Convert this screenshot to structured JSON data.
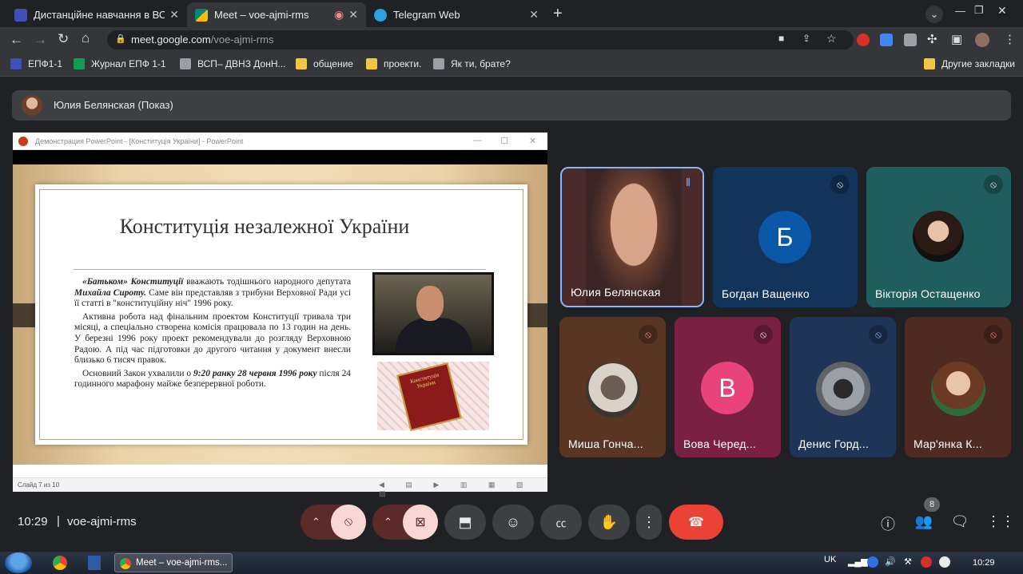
{
  "browser": {
    "tabs": [
      {
        "label": "Дистанційне навчання в ВСП",
        "icon": "forms-icon",
        "color": "#3f51b5"
      },
      {
        "label": "Meet – voe-ajmi-rms",
        "icon": "meet-icon",
        "color": "#00897b"
      },
      {
        "label": "Telegram Web",
        "icon": "telegram-icon",
        "color": "#2aa3df"
      }
    ],
    "url_host": "meet.google.com",
    "url_path": "/voe-ajmi-rms",
    "bookmarks": [
      {
        "label": "ЕПФ1-1",
        "color": "#3f51b5"
      },
      {
        "label": "Журнал ЕПФ 1-1",
        "color": "#0f9d58"
      },
      {
        "label": "ВСП– ДВНЗ ДонН...",
        "color": "#9aa0a6"
      },
      {
        "label": "общение",
        "color": "#f4c542"
      },
      {
        "label": "проекти.",
        "color": "#f4c542"
      },
      {
        "label": "Як ти, брате?",
        "color": "#9aa0a6"
      }
    ],
    "other_bookmarks": "Другие закладки"
  },
  "meet": {
    "presenter_label": "Юлия Белянская (Показ)",
    "ppt": {
      "window_title": "Демонстрация PowerPoint - [Конституція України] - PowerPoint",
      "slide_title": "Конституція незалежної України",
      "p1_a": "«Батьком» Конституції",
      "p1_b": " вважають тодішнього народного депутата ",
      "p1_c": "Михайла Сироту.",
      "p1_d": " Саме він представляв з трибуни Верховної Ради усі її статті в \"конституційну ніч\" 1996 року.",
      "p2": "Активна робота над фінальним проектом Конституції тривала три місяці, а спеціально створена комісія працювала по 13 годин на день. У березні 1996 року проект рекомендували до розгляду Верховною Радою. А під час підготовки до другого читання у документ внесли близько 6 тисяч правок.",
      "p3_a": "Основний Закон ухвалили о ",
      "p3_b": "9:20 ранку 28 червня 1996 року",
      "p3_c": " після 24 годинного марафону майже безперервної роботи.",
      "book_text": "Конституція України",
      "status": "Слайд 7 из 10"
    },
    "participants": [
      {
        "name": "Юлия Белянская",
        "type": "video",
        "bg": "#4a2b2a"
      },
      {
        "name": "Богдан Ващенко",
        "type": "letter",
        "letter": "Б",
        "bg": "#12345a",
        "circle": "#0b57a8"
      },
      {
        "name": "Вікторія Остащенко",
        "type": "photo",
        "bg": "#1f5e5c"
      },
      {
        "name": "Миша Гонча...",
        "type": "photo",
        "bg": "#5a3524"
      },
      {
        "name": "Вова Черед...",
        "type": "letter",
        "letter": "В",
        "bg": "#7a2043",
        "circle": "#e8437a"
      },
      {
        "name": "Денис Горд...",
        "type": "photo",
        "bg": "#1e3557"
      },
      {
        "name": "Мар'янка К...",
        "type": "photo",
        "bg": "#4e2a20"
      }
    ],
    "clock": "10:29",
    "meeting_code": "voe-ajmi-rms",
    "people_count": "8"
  },
  "taskbar": {
    "active_window": "Meet – voe-ajmi-rms...",
    "lang": "UK",
    "time": "10:29"
  }
}
